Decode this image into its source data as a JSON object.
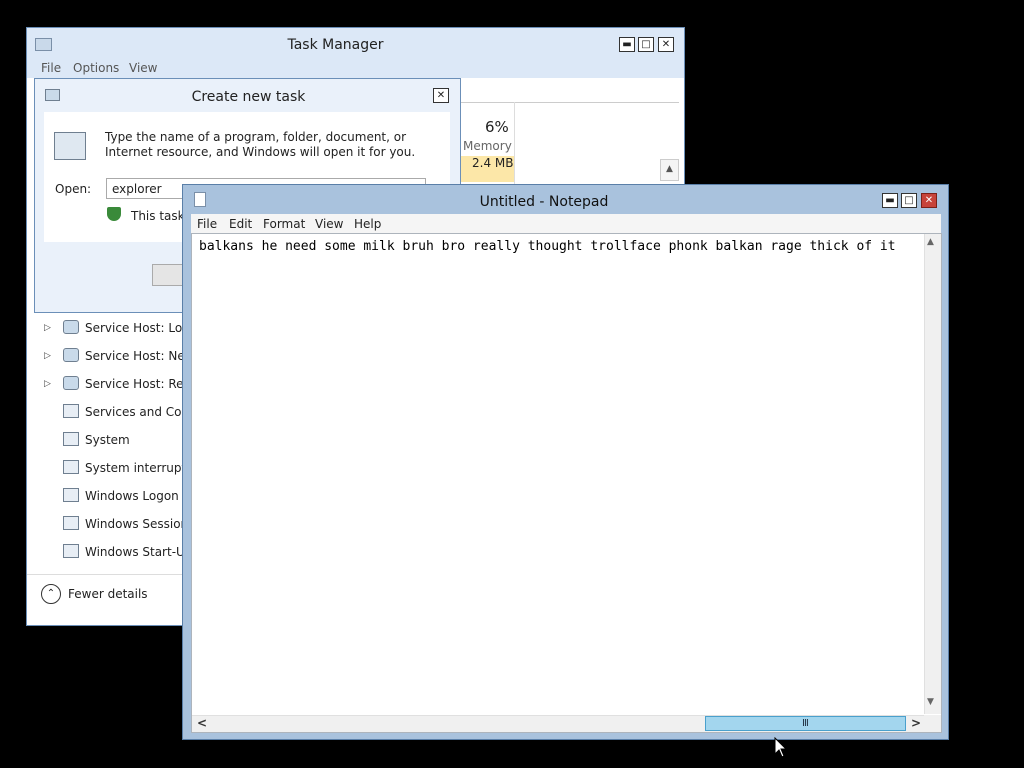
{
  "task_manager": {
    "title": "Task Manager",
    "menu": [
      "File",
      "Options",
      "View"
    ],
    "memory": {
      "percent": "6%",
      "label": "Memory",
      "value": "2.4 MB"
    },
    "processes": [
      {
        "label": "Service Host: Loca",
        "expandable": true,
        "icon": "gear-icon"
      },
      {
        "label": "Service Host: Netw",
        "expandable": true,
        "icon": "gear-icon"
      },
      {
        "label": "Service Host: Remo",
        "expandable": true,
        "icon": "gear-icon"
      },
      {
        "label": "Services and Contr",
        "expandable": false,
        "icon": "window-icon"
      },
      {
        "label": "System",
        "expandable": false,
        "icon": "window-icon"
      },
      {
        "label": "System interrupts",
        "expandable": false,
        "icon": "window-icon"
      },
      {
        "label": "Windows Logon A",
        "expandable": false,
        "icon": "window-icon"
      },
      {
        "label": "Windows Session M",
        "expandable": false,
        "icon": "window-icon"
      },
      {
        "label": "Windows Start-Up",
        "expandable": false,
        "icon": "window-icon"
      }
    ],
    "fewer_details": "Fewer details",
    "buttons": {
      "minimize": "▬",
      "maximize": "□",
      "close": "✕"
    }
  },
  "create_task": {
    "title": "Create new task",
    "description": "Type the name of a program, folder, document, or Internet resource, and Windows will open it for you.",
    "open_label": "Open:",
    "open_value": "explorer",
    "admin_note": "This task w",
    "close": "✕"
  },
  "notepad": {
    "title": "Untitled - Notepad",
    "menu": [
      "File",
      "Edit",
      "Format",
      "View",
      "Help"
    ],
    "text": "balkans he need some milk bruh bro really thought trollface phonk balkan rage thick of it",
    "buttons": {
      "minimize": "▬",
      "maximize": "□",
      "close": "✕"
    },
    "scroll": {
      "up": "▲",
      "down": "▼",
      "left": "<",
      "right": ">",
      "thumb": "Ⅲ"
    }
  },
  "colors": {
    "titlebar": "#dce8f7",
    "notepad_frame": "#a9c2dd",
    "close": "#c7433a",
    "memory_fill": "#fce7a8"
  }
}
